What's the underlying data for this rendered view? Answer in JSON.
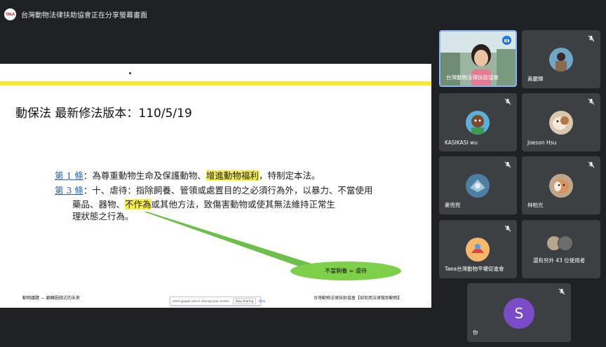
{
  "header": {
    "logo_text": "TALA",
    "presenting_text": "台灣動物法律扶助協會正在分享螢幕畫面"
  },
  "slide": {
    "title": "動保法 最新修法版本：110/5/19",
    "article1": {
      "link": "第 1 條",
      "text_a": "：為尊重動物生命及保護動物、",
      "highlight": "增進動物福利",
      "text_b": "，特制定本法。"
    },
    "article3": {
      "link": "第 3 條",
      "line1": "：十、虐待：指除飼養、管領或處置目的之必須行為外，以暴力、不當使用",
      "line2_a": "藥品、器物、",
      "line2_highlight": "不作為",
      "line2_b": "或其他方法，致傷害動物或使其無法維持正常生",
      "line3": "理狀態之行為。"
    },
    "bubble_text": "不當飼養 = 虐待",
    "footer_left": "動物議題 — 翻轉圈錢式的未來",
    "footer_right": "台灣動物法律扶助協會【如何用法律幫助動物】"
  },
  "share_bar": {
    "text": "meet.google.com is sharing your screen.",
    "stop_label": "Stop sharing",
    "hide_label": "Hide"
  },
  "participants": [
    {
      "name": "台灣動物法律扶助協會",
      "muted": false,
      "speaking": true
    },
    {
      "name": "黃慶輝",
      "muted": true
    },
    {
      "name": "KASIKASI wu",
      "muted": true
    },
    {
      "name": "Joeson Hsu",
      "muted": true
    },
    {
      "name": "麥兜兜",
      "muted": true
    },
    {
      "name": "林柏光",
      "muted": true
    },
    {
      "name": "Taea台灣動物平權促進會",
      "muted": true
    },
    {
      "name": "還有另外 43 位使用者",
      "muted": false
    }
  ],
  "self": {
    "initial": "S",
    "label": "你",
    "avatar_color": "#7b4cc7"
  },
  "colors": {
    "background": "#202124",
    "tile": "#3c4043",
    "accent_yellow": "#f7e933",
    "bubble_green": "#7ed04b",
    "active_speaker": "#8ab4f8"
  }
}
